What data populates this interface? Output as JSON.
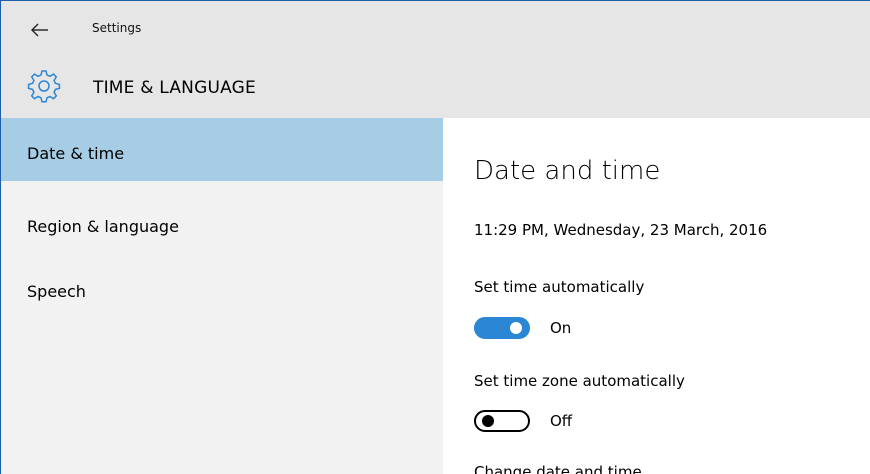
{
  "window": {
    "title": "Settings"
  },
  "header": {
    "section_title": "TIME & LANGUAGE",
    "icon": "gear-icon",
    "back_icon": "back-arrow-icon"
  },
  "sidebar": {
    "items": [
      {
        "label": "Date & time",
        "selected": true
      },
      {
        "label": "Region & language",
        "selected": false
      },
      {
        "label": "Speech",
        "selected": false
      }
    ]
  },
  "main": {
    "title": "Date and time",
    "current_datetime": "11:29 PM, Wednesday, 23 March, 2016",
    "settings": [
      {
        "label": "Set time automatically",
        "state": "On",
        "on": true
      },
      {
        "label": "Set time zone automatically",
        "state": "Off",
        "on": false
      }
    ],
    "next_heading": "Change date and time"
  },
  "colors": {
    "accent": "#2b86d5",
    "selected_bg": "#a7cde6",
    "titlebar_bg": "#e6e6e6",
    "sidebar_bg": "#f2f2f2"
  }
}
